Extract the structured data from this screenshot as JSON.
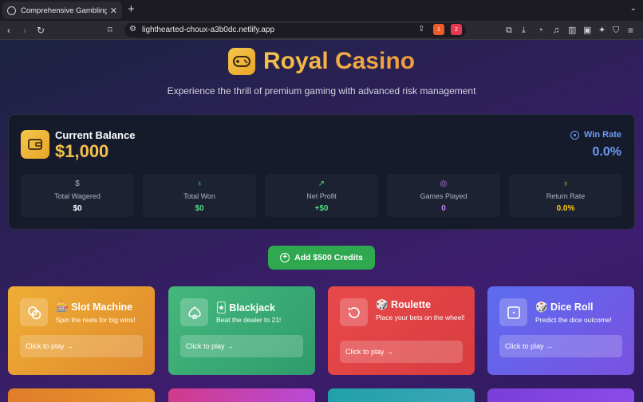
{
  "browser": {
    "tab_title": "Comprehensive Gambling App",
    "url": "lighthearted-choux-a3b0dc.netlify.app",
    "badge1": "1",
    "badge2": "2"
  },
  "header": {
    "title": "Royal Casino",
    "subtitle": "Experience the thrill of premium gaming with advanced risk management"
  },
  "balance": {
    "label": "Current Balance",
    "value": "$1,000",
    "win_rate_label": "Win Rate",
    "win_rate_value": "0.0%"
  },
  "stats": [
    {
      "label": "Total Wagered",
      "value": "$0",
      "icon": "dollar-icon",
      "color": "#ffffff"
    },
    {
      "label": "Total Won",
      "value": "$0",
      "icon": "award-icon",
      "color": "#4ade80"
    },
    {
      "label": "Net Profit",
      "value": "+$0",
      "icon": "trending-up-icon",
      "color": "#4ade80"
    },
    {
      "label": "Games Played",
      "value": "0",
      "icon": "target-icon",
      "color": "#c084fc"
    },
    {
      "label": "Return Rate",
      "value": "0.0%",
      "icon": "award-icon",
      "color": "#facc15"
    }
  ],
  "add_credits": "Add $500 Credits",
  "games": [
    {
      "title": "🎰 Slot Machine",
      "desc": "Spin the reels for big wins!",
      "play": "Click to play →",
      "icon": "coins-icon"
    },
    {
      "title": "🃏 Blackjack",
      "desc": "Beat the dealer to 21!",
      "play": "Click to play →",
      "icon": "spade-icon"
    },
    {
      "title": "🎲 Roulette",
      "desc": "Place your bets on the wheel!",
      "play": "Click to play →",
      "icon": "rotate-icon"
    },
    {
      "title": "🎲 Dice Roll",
      "desc": "Predict the dice outcome!",
      "play": "Click to play →",
      "icon": "dice-icon"
    }
  ],
  "colors": {
    "gold": "#f3c14c",
    "win_rate": "#6c9cf0",
    "add_button": "#2fa84f",
    "slot_card": "#e9a32f",
    "blackjack_card": "#3fb27a",
    "roulette_card": "#e2474a",
    "dice_card": "#6b63e6"
  }
}
